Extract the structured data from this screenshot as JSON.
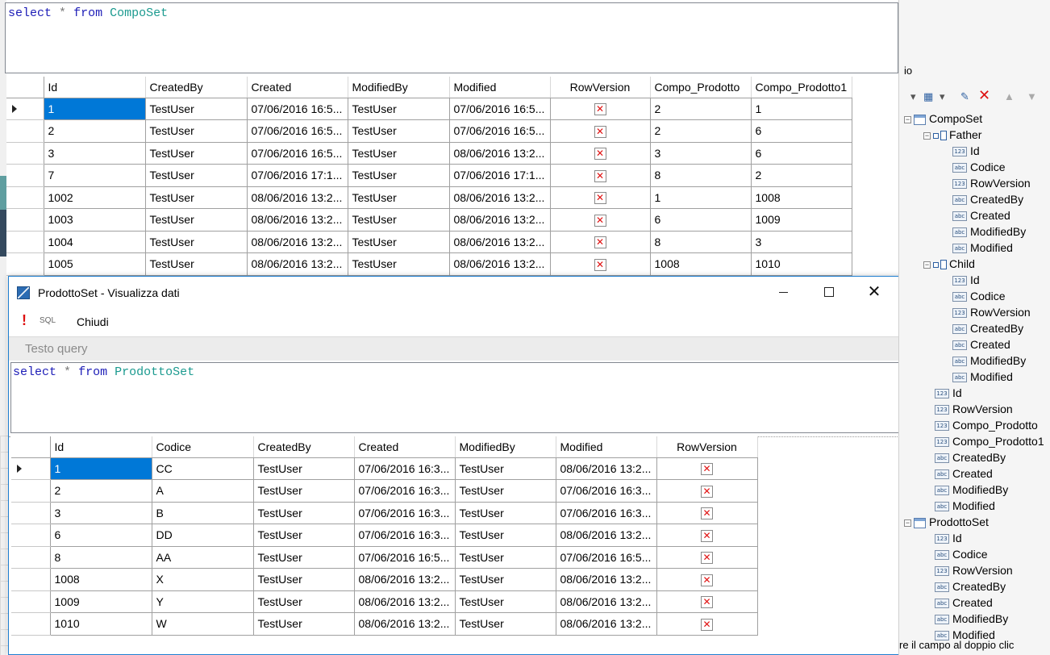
{
  "query1": {
    "keyword_select": "select",
    "operator": "*",
    "keyword_from": "from",
    "table": "CompoSet"
  },
  "grid1": {
    "columns": [
      "Id",
      "CreatedBy",
      "Created",
      "ModifiedBy",
      "Modified",
      "RowVersion",
      "Compo_Prodotto",
      "Compo_Prodotto1"
    ],
    "rows": [
      [
        "1",
        "TestUser",
        "07/06/2016 16:5...",
        "TestUser",
        "07/06/2016 16:5...",
        "✕",
        "2",
        "1"
      ],
      [
        "2",
        "TestUser",
        "07/06/2016 16:5...",
        "TestUser",
        "07/06/2016 16:5...",
        "✕",
        "2",
        "6"
      ],
      [
        "3",
        "TestUser",
        "07/06/2016 16:5...",
        "TestUser",
        "08/06/2016 13:2...",
        "✕",
        "3",
        "6"
      ],
      [
        "7",
        "TestUser",
        "07/06/2016 17:1...",
        "TestUser",
        "07/06/2016 17:1...",
        "✕",
        "8",
        "2"
      ],
      [
        "1002",
        "TestUser",
        "08/06/2016 13:2...",
        "TestUser",
        "08/06/2016 13:2...",
        "✕",
        "1",
        "1008"
      ],
      [
        "1003",
        "TestUser",
        "08/06/2016 13:2...",
        "TestUser",
        "08/06/2016 13:2...",
        "✕",
        "6",
        "1009"
      ],
      [
        "1004",
        "TestUser",
        "08/06/2016 13:2...",
        "TestUser",
        "08/06/2016 13:2...",
        "✕",
        "8",
        "3"
      ],
      [
        "1005",
        "TestUser",
        "08/06/2016 13:2...",
        "TestUser",
        "08/06/2016 13:2...",
        "✕",
        "1008",
        "1010"
      ]
    ]
  },
  "dialog": {
    "title": "ProdottoSet - Visualizza dati",
    "toolbar": {
      "execute_icon": "!",
      "sql_label": "SQL",
      "close_label": "Chiudi"
    },
    "section_label": "Testo query",
    "close_glyph": "✕"
  },
  "query2": {
    "keyword_select": "select",
    "operator": "*",
    "keyword_from": "from",
    "table": "ProdottoSet"
  },
  "grid2": {
    "columns": [
      "Id",
      "Codice",
      "CreatedBy",
      "Created",
      "ModifiedBy",
      "Modified",
      "RowVersion"
    ],
    "rows": [
      [
        "1",
        "CC",
        "TestUser",
        "07/06/2016 16:3...",
        "TestUser",
        "08/06/2016 13:2...",
        "✕"
      ],
      [
        "2",
        "A",
        "TestUser",
        "07/06/2016 16:3...",
        "TestUser",
        "07/06/2016 16:3...",
        "✕"
      ],
      [
        "3",
        "B",
        "TestUser",
        "07/06/2016 16:3...",
        "TestUser",
        "07/06/2016 16:3...",
        "✕"
      ],
      [
        "6",
        "DD",
        "TestUser",
        "07/06/2016 16:3...",
        "TestUser",
        "08/06/2016 13:2...",
        "✕"
      ],
      [
        "8",
        "AA",
        "TestUser",
        "07/06/2016 16:5...",
        "TestUser",
        "07/06/2016 16:5...",
        "✕"
      ],
      [
        "1008",
        "X",
        "TestUser",
        "08/06/2016 13:2...",
        "TestUser",
        "08/06/2016 13:2...",
        "✕"
      ],
      [
        "1009",
        "Y",
        "TestUser",
        "08/06/2016 13:2...",
        "TestUser",
        "08/06/2016 13:2...",
        "✕"
      ],
      [
        "1010",
        "W",
        "TestUser",
        "08/06/2016 13:2...",
        "TestUser",
        "08/06/2016 13:2...",
        "✕"
      ]
    ]
  },
  "explorer": {
    "top_stub": "io",
    "status_text": "re il campo al doppio clic",
    "toolbar_icons": [
      "dropdown-arrow-icon",
      "new-table-icon",
      "edit-icon",
      "delete-icon",
      "move-up-icon",
      "move-down-icon"
    ],
    "tree": [
      {
        "label": "CompoSet",
        "icon": "table",
        "level": 0,
        "expander": "−"
      },
      {
        "label": "Father",
        "icon": "relation",
        "level": 1,
        "expander": "−"
      },
      {
        "label": "Id",
        "icon": "123",
        "level": 2
      },
      {
        "label": "Codice",
        "icon": "abc",
        "level": 2
      },
      {
        "label": "RowVersion",
        "icon": "123",
        "level": 2
      },
      {
        "label": "CreatedBy",
        "icon": "abc",
        "level": 2
      },
      {
        "label": "Created",
        "icon": "abc",
        "level": 2
      },
      {
        "label": "ModifiedBy",
        "icon": "abc",
        "level": 2
      },
      {
        "label": "Modified",
        "icon": "abc",
        "level": 2
      },
      {
        "label": "Child",
        "icon": "relation",
        "level": 1,
        "expander": "−"
      },
      {
        "label": "Id",
        "icon": "123",
        "level": 2
      },
      {
        "label": "Codice",
        "icon": "abc",
        "level": 2
      },
      {
        "label": "RowVersion",
        "icon": "123",
        "level": 2
      },
      {
        "label": "CreatedBy",
        "icon": "abc",
        "level": 2
      },
      {
        "label": "Created",
        "icon": "abc",
        "level": 2
      },
      {
        "label": "ModifiedBy",
        "icon": "abc",
        "level": 2
      },
      {
        "label": "Modified",
        "icon": "abc",
        "level": 2
      },
      {
        "label": "Id",
        "icon": "123",
        "level": 1
      },
      {
        "label": "RowVersion",
        "icon": "123",
        "level": 1
      },
      {
        "label": "Compo_Prodotto",
        "icon": "123",
        "level": 1
      },
      {
        "label": "Compo_Prodotto1",
        "icon": "123",
        "level": 1
      },
      {
        "label": "CreatedBy",
        "icon": "abc",
        "level": 1
      },
      {
        "label": "Created",
        "icon": "abc",
        "level": 1
      },
      {
        "label": "ModifiedBy",
        "icon": "abc",
        "level": 1
      },
      {
        "label": "Modified",
        "icon": "abc",
        "level": 1
      },
      {
        "label": "ProdottoSet",
        "icon": "table",
        "level": 0,
        "expander": "−"
      },
      {
        "label": "Id",
        "icon": "123",
        "level": 1
      },
      {
        "label": "Codice",
        "icon": "abc",
        "level": 1
      },
      {
        "label": "RowVersion",
        "icon": "123",
        "level": 1
      },
      {
        "label": "CreatedBy",
        "icon": "abc",
        "level": 1
      },
      {
        "label": "Created",
        "icon": "abc",
        "level": 1
      },
      {
        "label": "ModifiedBy",
        "icon": "abc",
        "level": 1
      },
      {
        "label": "Modified",
        "icon": "abc",
        "level": 1
      }
    ]
  },
  "colors": {
    "accent": "#0078d7",
    "keyword": "#1c1cb7",
    "table_name": "#1b9a8f",
    "null_x": "#e01010"
  }
}
